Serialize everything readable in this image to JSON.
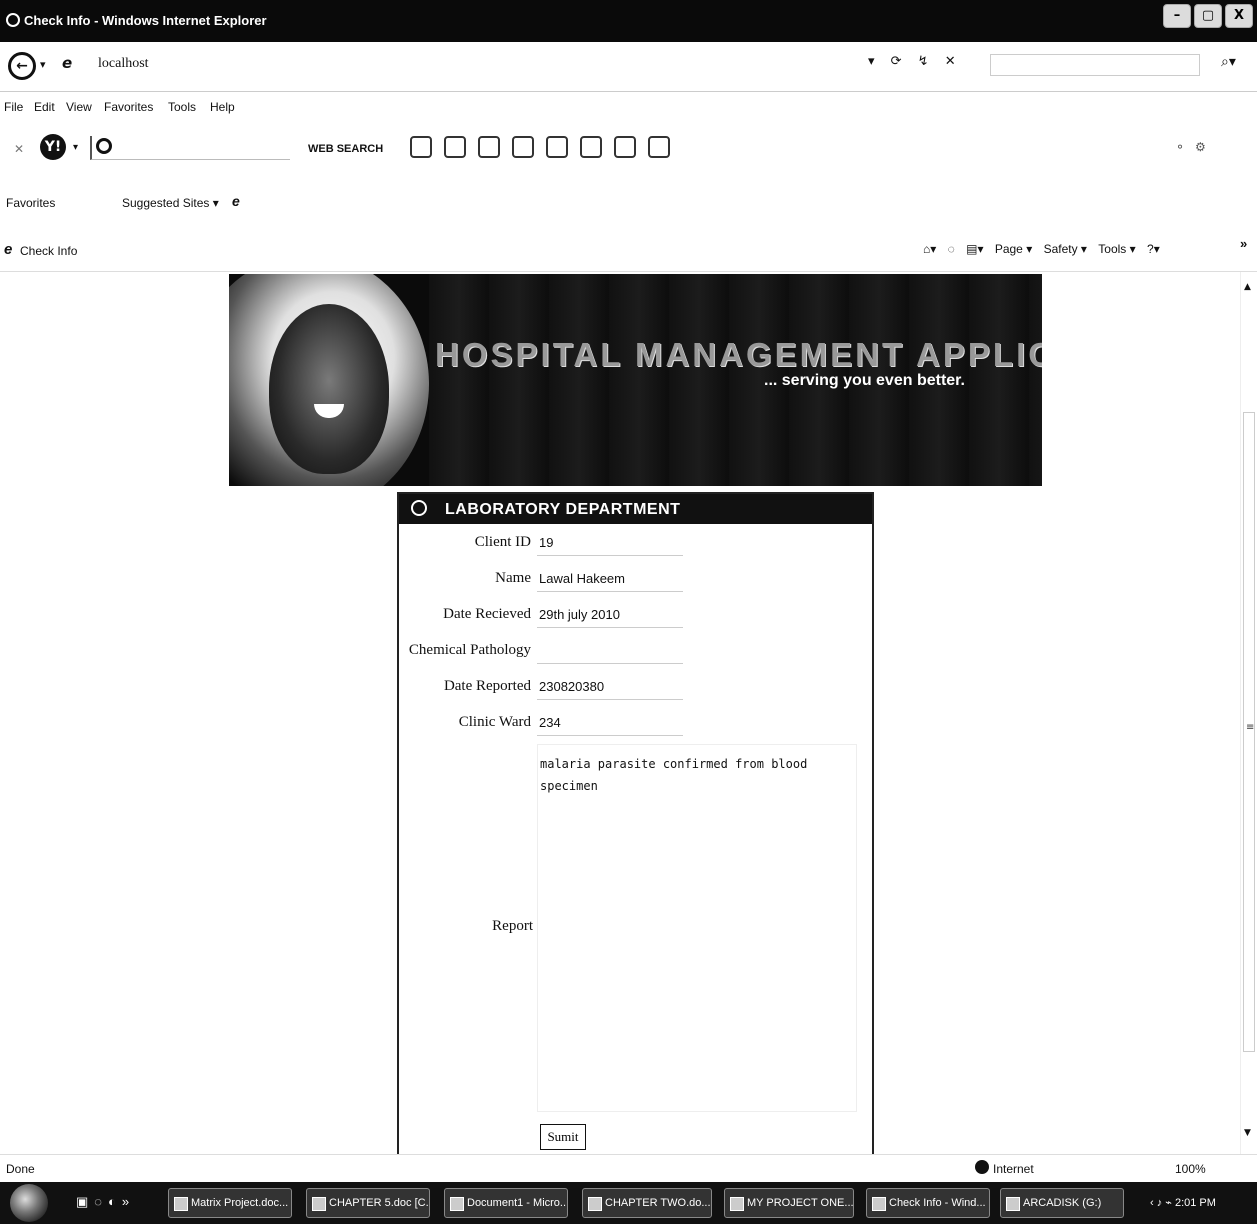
{
  "window": {
    "title": "Check Info - Windows Internet Explorer",
    "buttons": [
      "–",
      "▢",
      "X"
    ]
  },
  "address_bar": {
    "url": "localhost",
    "right_icons": "▾ ⟳ ↯ ✕",
    "search_placeholder": ""
  },
  "menu": [
    "File",
    "Edit",
    "View",
    "Favorites",
    "Tools",
    "Help"
  ],
  "toolbar": {
    "web_search": "WEB SEARCH"
  },
  "favorites_bar": {
    "favorites": "Favorites",
    "suggested": "Suggested Sites ▾"
  },
  "tab": {
    "title": "Check Info"
  },
  "command_bar": {
    "page": "Page ▾",
    "safety": "Safety ▾",
    "tools": "Tools ▾",
    "help": "?▾"
  },
  "banner": {
    "title": "HOSPITAL MANAGEMENT APPLICATION",
    "slogan": "... serving you even better."
  },
  "panel": {
    "title": "LABORATORY DEPARTMENT"
  },
  "form": {
    "client_id": {
      "label": "Client ID",
      "value": "19"
    },
    "name": {
      "label": "Name",
      "value": "Lawal Hakeem"
    },
    "date_received": {
      "label": "Date Recieved",
      "value": "29th july 2010"
    },
    "chemical_pathology": {
      "label": "Chemical Pathology",
      "value": ""
    },
    "date_reported": {
      "label": "Date Reported",
      "value": "230820380"
    },
    "clinic_ward": {
      "label": "Clinic Ward",
      "value": "234"
    },
    "report": {
      "label": "Report",
      "value": "malaria parasite confirmed from blood specimen"
    },
    "submit_label": "Sumit"
  },
  "status_bar": {
    "status": "Done",
    "zone": "Internet",
    "zoom": "100%"
  },
  "taskbar": {
    "tasks": [
      "Matrix Project.doc...",
      "CHAPTER 5.doc [C...",
      "Document1 - Micro...",
      "CHAPTER TWO.do...",
      "MY PROJECT ONE...",
      "Check Info - Wind...",
      "ARCADISK (G:)"
    ],
    "clock": "2:01 PM"
  }
}
